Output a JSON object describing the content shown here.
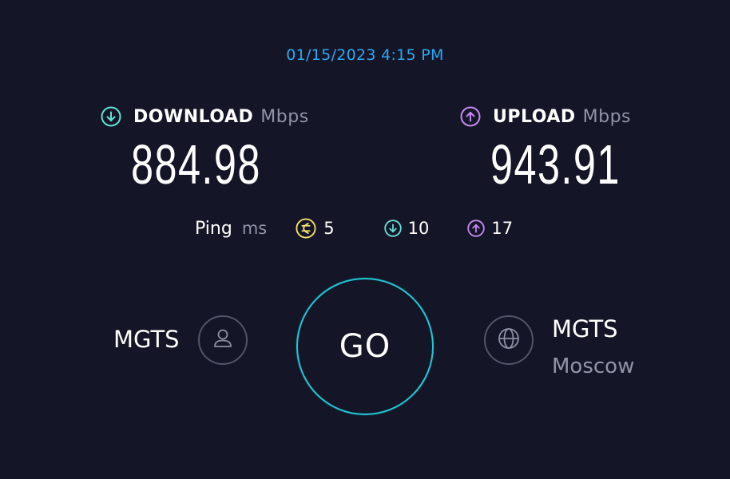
{
  "header": {
    "timestamp": "01/15/2023 4:15 PM"
  },
  "download": {
    "label": "DOWNLOAD",
    "unit": "Mbps",
    "value": "884.98",
    "icon": "download-arrow-icon",
    "color": "#5fe3d7"
  },
  "upload": {
    "label": "UPLOAD",
    "unit": "Mbps",
    "value": "943.91",
    "icon": "upload-arrow-icon",
    "color": "#c68bf2"
  },
  "ping": {
    "label": "Ping",
    "unit": "ms",
    "jitter": "5",
    "jitter_color": "#f4e36a",
    "download_latency": "10",
    "upload_latency": "17"
  },
  "action": {
    "go_label": "GO",
    "ring_color": "#22c7d6"
  },
  "isp": {
    "name": "MGTS",
    "icon": "user-icon"
  },
  "server": {
    "name": "MGTS",
    "location": "Moscow",
    "icon": "globe-icon"
  },
  "colors": {
    "background": "#141526",
    "timestamp": "#2aa9f5",
    "muted": "#9193a8"
  }
}
